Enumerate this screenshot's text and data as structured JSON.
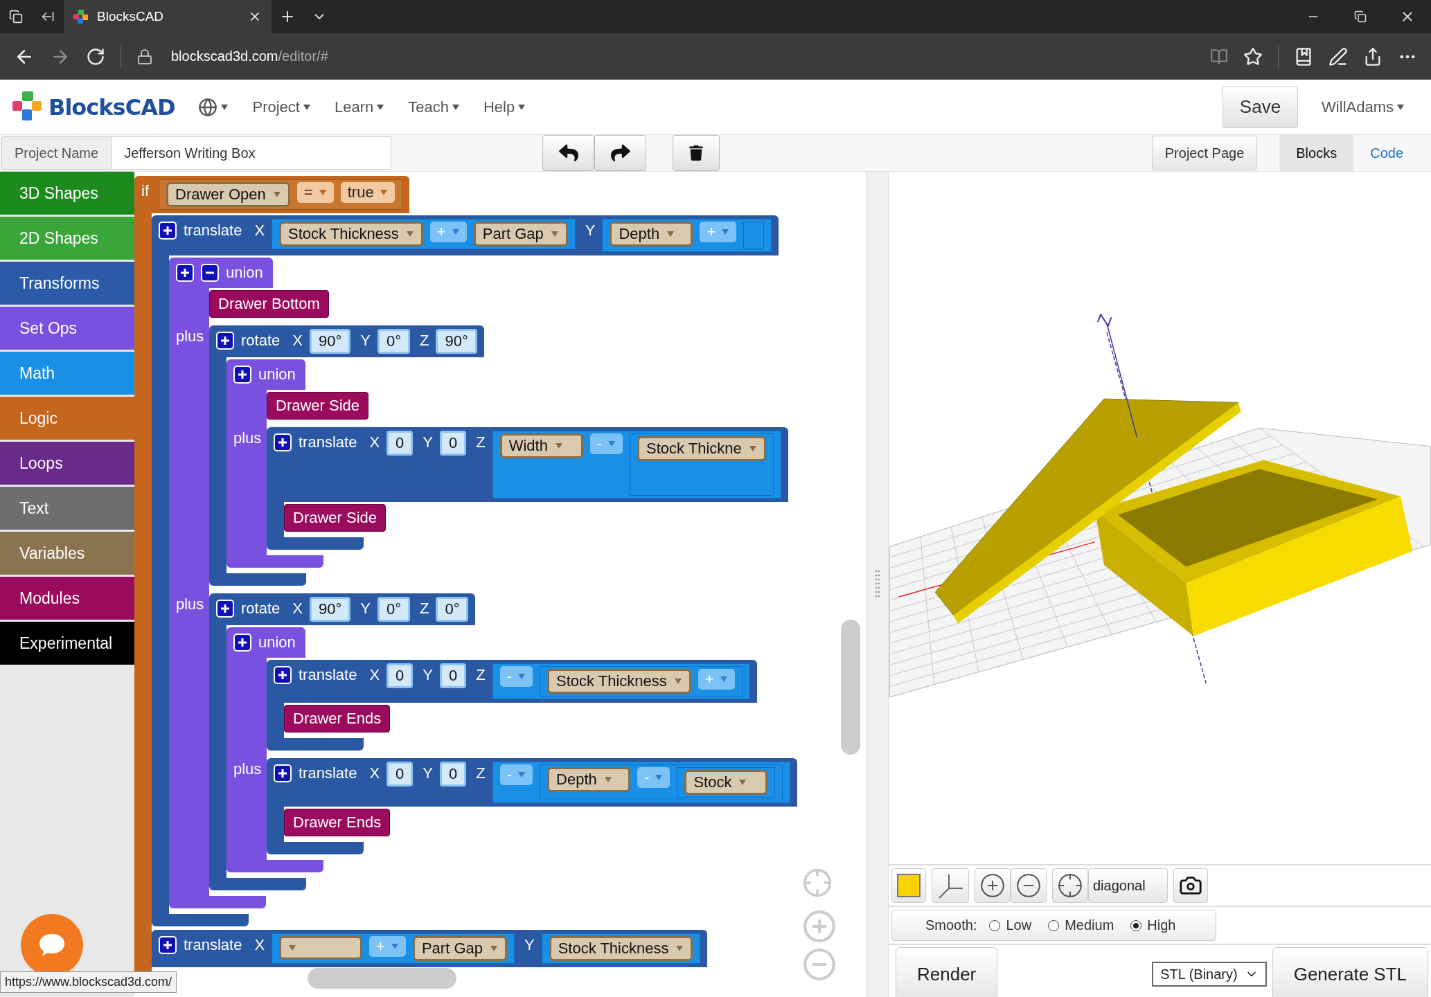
{
  "browser": {
    "tab_title": "BlocksCAD",
    "address": {
      "domain": "blockscad3d.com",
      "path": "/editor/#"
    }
  },
  "nav": {
    "logo": "BlocksCAD",
    "menus": [
      {
        "label": "Project"
      },
      {
        "label": "Learn"
      },
      {
        "label": "Teach"
      },
      {
        "label": "Help"
      }
    ],
    "save": "Save",
    "user": "WillAdams"
  },
  "project": {
    "label": "Project Name",
    "name": "Jefferson Writing Box",
    "project_page": "Project Page",
    "views": [
      {
        "label": "Blocks",
        "selected": true
      },
      {
        "label": "Code",
        "selected": false
      }
    ]
  },
  "categories": [
    {
      "label": "3D Shapes",
      "color": "#1d8a1d"
    },
    {
      "label": "2D Shapes",
      "color": "#3aa63a"
    },
    {
      "label": "Transforms",
      "color": "#2a5aa8"
    },
    {
      "label": "Set Ops",
      "color": "#7a50e0"
    },
    {
      "label": "Math",
      "color": "#1a8fe6"
    },
    {
      "label": "Logic",
      "color": "#c4661e"
    },
    {
      "label": "Loops",
      "color": "#6a2a8c"
    },
    {
      "label": "Text",
      "color": "#6e6e6e"
    },
    {
      "label": "Variables",
      "color": "#8a7450"
    },
    {
      "label": "Modules",
      "color": "#9b0b5d"
    },
    {
      "label": "Experimental",
      "color": "#000000"
    }
  ],
  "workspace": {
    "blocks": [
      {
        "kind": "if",
        "label": "if",
        "condition": {
          "kind": "compare",
          "left": {
            "kind": "variable",
            "name": "Drawer Open"
          },
          "op": "=",
          "right": {
            "kind": "boolean",
            "text": "true"
          }
        },
        "sections": [
          {
            "blocks": [
              {
                "kind": "transform",
                "label": "translate",
                "args": [
                  {
                    "axis": "X",
                    "value": {
                      "kind": "math",
                      "left": {
                        "kind": "variable",
                        "name": "Stock Thickness"
                      },
                      "op": "+",
                      "right": {
                        "kind": "variable",
                        "name": "Part Gap"
                      }
                    }
                  },
                  {
                    "axis": "Y",
                    "value": {
                      "kind": "math",
                      "left": {
                        "kind": "variable",
                        "name": "Depth"
                      },
                      "op": "+",
                      "right": {
                        "kind": "stub"
                      }
                    }
                  }
                ],
                "sections": [
                  {
                    "blocks": [
                      {
                        "kind": "setop",
                        "label": "union",
                        "removable": true,
                        "sections": [
                          {
                            "blocks": [
                              {
                                "kind": "module",
                                "name": "Drawer Bottom"
                              }
                            ]
                          },
                          {
                            "label": "plus",
                            "blocks": [
                              {
                                "kind": "transform",
                                "label": "rotate",
                                "args": [
                                  {
                                    "axis": "X",
                                    "value": {
                                      "kind": "number",
                                      "text": "90°"
                                    }
                                  },
                                  {
                                    "axis": "Y",
                                    "value": {
                                      "kind": "number",
                                      "text": "0°"
                                    }
                                  },
                                  {
                                    "axis": "Z",
                                    "value": {
                                      "kind": "number",
                                      "text": "90°"
                                    }
                                  }
                                ],
                                "sections": [
                                  {
                                    "blocks": [
                                      {
                                        "kind": "setop",
                                        "label": "union",
                                        "removable": false,
                                        "sections": [
                                          {
                                            "blocks": [
                                              {
                                                "kind": "module",
                                                "name": "Drawer Side"
                                              }
                                            ]
                                          },
                                          {
                                            "label": "plus",
                                            "blocks": [
                                              {
                                                "kind": "transform",
                                                "label": "translate",
                                                "args": [
                                                  {
                                                    "axis": "X",
                                                    "value": {
                                                      "kind": "number",
                                                      "text": "0"
                                                    }
                                                  },
                                                  {
                                                    "axis": "Y",
                                                    "value": {
                                                      "kind": "number",
                                                      "text": "0"
                                                    }
                                                  },
                                                  {
                                                    "axis": "Z",
                                                    "value": {
                                                      "kind": "math",
                                                      "left": {
                                                        "kind": "variable",
                                                        "name": "Width"
                                                      },
                                                      "op": "-",
                                                      "right": {
                                                        "kind": "math",
                                                        "tall": true,
                                                        "left": {
                                                          "kind": "variable",
                                                          "name": "Stock Thickne"
                                                        }
                                                      }
                                                    }
                                                  }
                                                ],
                                                "sections": [
                                                  {
                                                    "blocks": [
                                                      {
                                                        "kind": "module",
                                                        "name": "Drawer Side"
                                                      }
                                                    ]
                                                  }
                                                ]
                                              }
                                            ]
                                          }
                                        ]
                                      }
                                    ]
                                  }
                                ]
                              }
                            ]
                          },
                          {
                            "label": "plus",
                            "blocks": [
                              {
                                "kind": "transform",
                                "label": "rotate",
                                "args": [
                                  {
                                    "axis": "X",
                                    "value": {
                                      "kind": "number",
                                      "text": "90°"
                                    }
                                  },
                                  {
                                    "axis": "Y",
                                    "value": {
                                      "kind": "number",
                                      "text": "0°"
                                    }
                                  },
                                  {
                                    "axis": "Z",
                                    "value": {
                                      "kind": "number",
                                      "text": "0°"
                                    }
                                  }
                                ],
                                "sections": [
                                  {
                                    "blocks": [
                                      {
                                        "kind": "setop",
                                        "label": "union",
                                        "removable": false,
                                        "sections": [
                                          {
                                            "blocks": [
                                              {
                                                "kind": "transform",
                                                "label": "translate",
                                                "args": [
                                                  {
                                                    "axis": "X",
                                                    "value": {
                                                      "kind": "number",
                                                      "text": "0"
                                                    }
                                                  },
                                                  {
                                                    "axis": "Y",
                                                    "value": {
                                                      "kind": "number",
                                                      "text": "0"
                                                    }
                                                  },
                                                  {
                                                    "axis": "Z",
                                                    "value": {
                                                      "kind": "math",
                                                      "op": "-",
                                                      "right": {
                                                        "kind": "math",
                                                        "left": {
                                                          "kind": "variable",
                                                          "name": "Stock Thickness"
                                                        },
                                                        "op": "+"
                                                      }
                                                    }
                                                  }
                                                ],
                                                "sections": [
                                                  {
                                                    "blocks": [
                                                      {
                                                        "kind": "module",
                                                        "name": "Drawer Ends"
                                                      }
                                                    ]
                                                  }
                                                ]
                                              }
                                            ]
                                          },
                                          {
                                            "label": "plus",
                                            "blocks": [
                                              {
                                                "kind": "transform",
                                                "label": "translate",
                                                "args": [
                                                  {
                                                    "axis": "X",
                                                    "value": {
                                                      "kind": "number",
                                                      "text": "0"
                                                    }
                                                  },
                                                  {
                                                    "axis": "Y",
                                                    "value": {
                                                      "kind": "number",
                                                      "text": "0"
                                                    }
                                                  },
                                                  {
                                                    "axis": "Z",
                                                    "value": {
                                                      "kind": "math",
                                                      "op": "-",
                                                      "right": {
                                                        "kind": "math",
                                                        "left": {
                                                          "kind": "variable",
                                                          "name": "Depth"
                                                        },
                                                        "op": "-",
                                                        "right": {
                                                          "kind": "math",
                                                          "left": {
                                                            "kind": "variable",
                                                            "name": "Stock"
                                                          }
                                                        }
                                                      }
                                                    }
                                                  }
                                                ],
                                                "sections": [
                                                  {
                                                    "blocks": [
                                                      {
                                                        "kind": "module",
                                                        "name": "Drawer Ends"
                                                      }
                                                    ]
                                                  }
                                                ]
                                              }
                                            ]
                                          }
                                        ]
                                      }
                                    ]
                                  }
                                ]
                              }
                            ]
                          }
                        ]
                      }
                    ]
                  }
                ]
              },
              {
                "kind": "transform",
                "label": "translate",
                "args": [
                  {
                    "axis": "X",
                    "value": {
                      "kind": "math",
                      "left": {
                        "kind": "variable"
                      },
                      "op": "+",
                      "right": {
                        "kind": "variable",
                        "name": "Part Gap"
                      }
                    }
                  },
                  {
                    "axis": "Y",
                    "value": {
                      "kind": "math",
                      "left": {
                        "kind": "variable",
                        "name": "Stock Thickness"
                      }
                    }
                  }
                ]
              }
            ]
          }
        ]
      }
    ]
  },
  "viewer": {
    "axis_label": "Z",
    "view": "diagonal",
    "smooth": {
      "label": "Smooth:",
      "options": [
        {
          "label": "Low",
          "selected": false
        },
        {
          "label": "Medium",
          "selected": false
        },
        {
          "label": "High",
          "selected": true
        }
      ]
    },
    "render": "Render",
    "format": "STL (Binary)",
    "generate": "Generate STL"
  },
  "status_url": "https://www.blockscad3d.com/"
}
